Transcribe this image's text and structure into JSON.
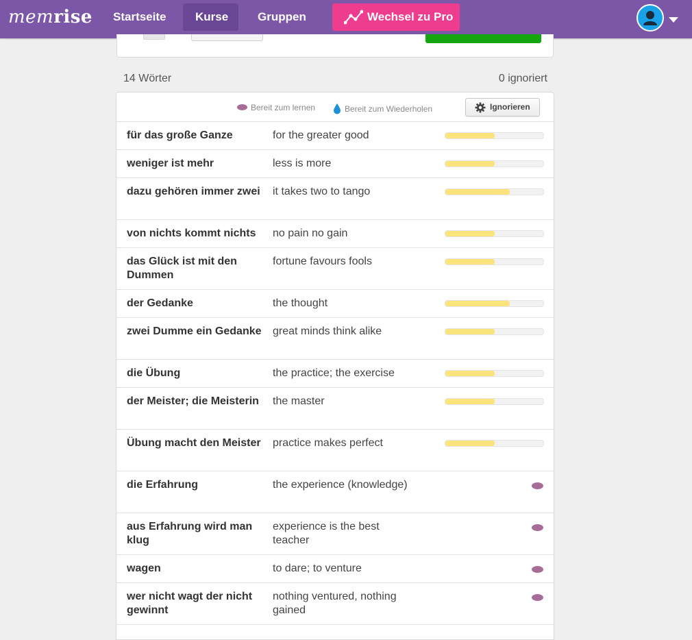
{
  "nav": {
    "logo_light": "mem",
    "logo_bold": "rise",
    "home": "Startseite",
    "courses": "Kurse",
    "groups": "Gruppen",
    "pro": "Wechsel zu Pro",
    "pro_color": "#ee3d8f",
    "bar_color": "#7c57a8"
  },
  "summary": {
    "word_count": "14 Wörter",
    "ignored": "0 ignoriert"
  },
  "legend": {
    "ready_to_learn": "Bereit zum lernen",
    "ready_to_review": "Bereit zum Wiederholen",
    "ignore_button": "Ignorieren"
  },
  "words": [
    {
      "front": "für das große Ganze",
      "back": "for the greater good",
      "progress": 0.5,
      "status": "learning"
    },
    {
      "front": "weniger ist mehr",
      "back": "less is more",
      "progress": 0.5,
      "status": "learning"
    },
    {
      "front": "dazu gehören immer zwei",
      "back": "it takes two to tango",
      "progress": 0.66,
      "status": "learning"
    },
    {
      "front": "von nichts kommt nichts",
      "back": "no pain no gain",
      "progress": 0.5,
      "status": "learning"
    },
    {
      "front": "das Glück ist mit den Dummen",
      "back": "fortune favours fools",
      "progress": 0.5,
      "status": "learning"
    },
    {
      "front": "der Gedanke",
      "back": "the thought",
      "progress": 0.66,
      "status": "learning"
    },
    {
      "front": "zwei Dumme ein Gedanke",
      "back": "great minds think alike",
      "progress": 0.5,
      "status": "learning"
    },
    {
      "front": "die Übung",
      "back": "the practice; the exercise",
      "progress": 0.5,
      "status": "learning"
    },
    {
      "front": "der Meister; die Meisterin",
      "back": "the master",
      "progress": 0.5,
      "status": "learning"
    },
    {
      "front": "Übung macht den Meister",
      "back": "practice makes perfect",
      "progress": 0.5,
      "status": "learning"
    },
    {
      "front": "die Erfahrung",
      "back": "the experience (knowledge)",
      "progress": 0,
      "status": "ready-to-learn"
    },
    {
      "front": "aus Erfahrung wird man klug",
      "back": "experience is the best teacher",
      "progress": 0,
      "status": "ready-to-learn"
    },
    {
      "front": "wagen",
      "back": "to dare; to venture",
      "progress": 0,
      "status": "ready-to-learn"
    },
    {
      "front": "wer nicht wagt der nicht gewinnt",
      "back": "nothing ventured, nothing gained",
      "progress": 0,
      "status": "ready-to-learn"
    }
  ]
}
